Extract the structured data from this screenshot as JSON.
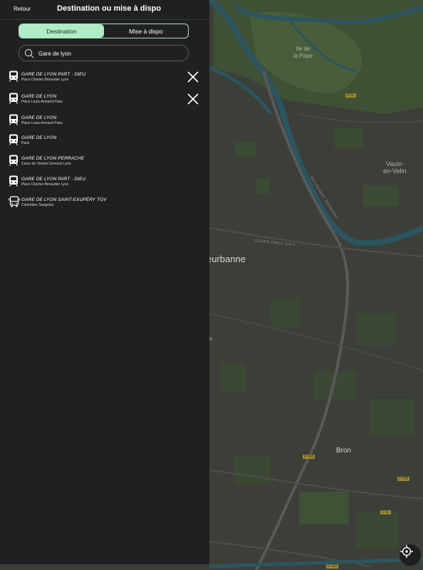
{
  "header": {
    "back_label": "Retour",
    "title": "Destination ou mise à dispo"
  },
  "segment": {
    "options": [
      "Destination",
      "Mise à dispo"
    ],
    "selected": "Destination"
  },
  "search": {
    "value": "Gare de lyon",
    "icon": "search-icon"
  },
  "results": [
    {
      "title": "GARE DE LYON PART - DIEU",
      "subtitle": "Place Charles Béraudier Lyon",
      "icon": "train-icon",
      "removable": true
    },
    {
      "title": "GARE DE LYON",
      "subtitle": "Place Louis-Armand Paris",
      "icon": "train-icon",
      "removable": true
    },
    {
      "title": "GARE DE LYON",
      "subtitle": "Place Louis-Armand Paris",
      "icon": "train-icon",
      "removable": false
    },
    {
      "title": "GARE DE LYON",
      "subtitle": "Paris",
      "icon": "train-icon",
      "removable": false
    },
    {
      "title": "GARE DE LYON PERRACHE",
      "subtitle": "Cours de Verdun Gensoul Lyon",
      "icon": "train-icon",
      "removable": false
    },
    {
      "title": "GARE DE LYON PART - DIEU",
      "subtitle": "Place Charles Béraudier Lyon",
      "icon": "train-icon",
      "removable": false
    },
    {
      "title": "GARE DE LYON SAINT-EXUPÉRY TGV",
      "subtitle": "Colombier-Saugnieu",
      "icon": "bus-icon",
      "removable": false
    }
  ],
  "map": {
    "labels": {
      "city_1": "eurbanne",
      "city_2": "Bron",
      "town_1": "Vaulx-\nen-Velin",
      "park": "Ile de\nla Pape",
      "street_1": "COURS EMILE ZOLA",
      "street_2": "BD LAURENT BONNEVAY",
      "letter_r": "R",
      "road_1": "D 62",
      "road_2": "D 383",
      "road_3": "D 506",
      "road_4": "D 81",
      "road_5": "D 103"
    },
    "locate_icon": "crosshair-icon"
  },
  "colors": {
    "accent": "#b0ecc6",
    "panel_bg": "#1f2021",
    "text": "#ffffff"
  }
}
